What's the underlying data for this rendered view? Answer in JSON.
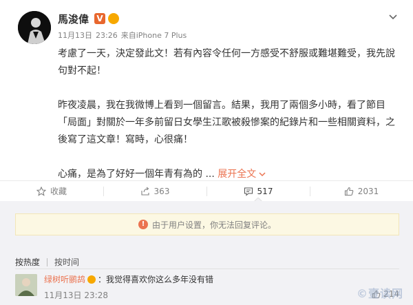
{
  "post": {
    "author": "馬浚偉",
    "verified_badge": "V",
    "meta": {
      "date": "11月13日",
      "time": "23:26",
      "source_prefix": "来自",
      "source": "iPhone 7 Plus"
    },
    "paragraphs": [
      "考慮了一天，決定發此文！若有內容令任何一方感受不舒服或難堪難受，我先說句對不起！",
      "昨夜凌晨，我在我微博上看到一個留言。結果，我用了兩個多小時，看了節目「局面」對關於一年多前留日女學生江歌被殺慘案的紀錄片和一些相關資料，之後寫了這文章！寫時，心很痛！"
    ],
    "teaser": "心痛，是為了好好一個年青有為的 ...",
    "expand_label": "展开全文"
  },
  "actions": [
    {
      "icon": "star-icon",
      "label": "收藏"
    },
    {
      "icon": "share-icon",
      "label": "363"
    },
    {
      "icon": "comment-icon",
      "label": "517"
    },
    {
      "icon": "thumbs-up-icon",
      "label": "2031"
    }
  ],
  "notice": {
    "text": "由于用户设置，你无法回复评论。"
  },
  "sort": {
    "hot": "按热度",
    "time": "按时间"
  },
  "comment": {
    "user": "绿树听鹂鸪",
    "text": "：我觉得喜欢你这么多年没有错",
    "date": "11月13日",
    "time": "23:28",
    "likes": "214"
  },
  "watermark": "©壹读网",
  "colors": {
    "accent": "#eb7350",
    "notice_bg": "#fcf8e3",
    "panel_bg": "#f2f2f5",
    "verified": "#e8672e"
  }
}
